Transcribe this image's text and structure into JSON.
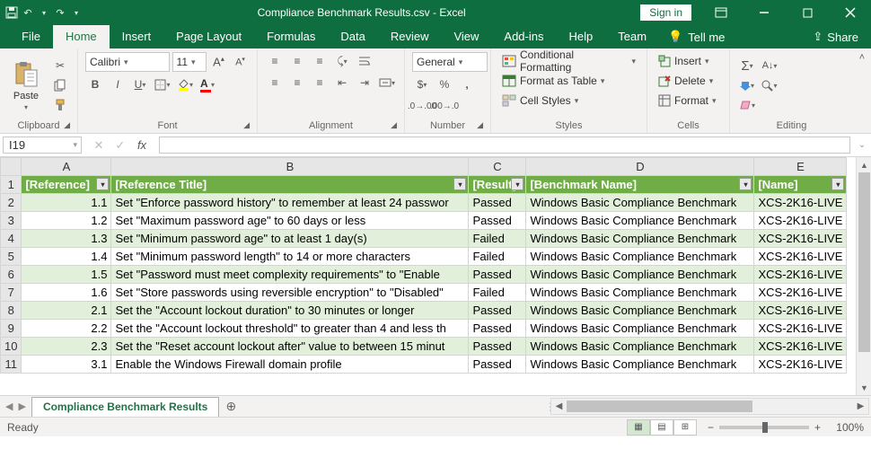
{
  "app": {
    "title": "Compliance Benchmark Results.csv  -  Excel",
    "signin": "Sign in"
  },
  "qat": {
    "save": "💾",
    "undo": "↶",
    "redo": "↷"
  },
  "tabs": {
    "file": "File",
    "home": "Home",
    "insert": "Insert",
    "pagelayout": "Page Layout",
    "formulas": "Formulas",
    "data": "Data",
    "review": "Review",
    "view": "View",
    "addins": "Add-ins",
    "help": "Help",
    "team": "Team",
    "tellme": "Tell me",
    "share": "Share"
  },
  "ribbon": {
    "clipboard": {
      "label": "Clipboard",
      "paste": "Paste"
    },
    "font": {
      "label": "Font",
      "face": "Calibri",
      "size": "11"
    },
    "alignment": {
      "label": "Alignment"
    },
    "number": {
      "label": "Number",
      "format": "General"
    },
    "styles": {
      "label": "Styles",
      "cond": "Conditional Formatting",
      "table": "Format as Table",
      "cell": "Cell Styles"
    },
    "cells": {
      "label": "Cells",
      "insert": "Insert",
      "delete": "Delete",
      "format": "Format"
    },
    "editing": {
      "label": "Editing"
    }
  },
  "formula": {
    "cellref": "I19"
  },
  "cols": [
    "A",
    "B",
    "C",
    "D",
    "E"
  ],
  "headers": {
    "a": "[Reference]",
    "b": "[Reference Title]",
    "c": "[Result]",
    "d": "[Benchmark Name]",
    "e": "[Name]"
  },
  "rows": [
    {
      "n": 2,
      "a": "1.1",
      "b": "Set \"Enforce password history\" to remember at least 24 passwor",
      "c": "Passed",
      "d": "Windows Basic Compliance Benchmark",
      "e": "XCS-2K16-LIVE",
      "band": "A"
    },
    {
      "n": 3,
      "a": "1.2",
      "b": "Set \"Maximum password age\" to 60 days or less",
      "c": "Passed",
      "d": "Windows Basic Compliance Benchmark",
      "e": "XCS-2K16-LIVE",
      "band": "B"
    },
    {
      "n": 4,
      "a": "1.3",
      "b": "Set \"Minimum password age\" to at least 1 day(s)",
      "c": "Failed",
      "d": "Windows Basic Compliance Benchmark",
      "e": "XCS-2K16-LIVE",
      "band": "A"
    },
    {
      "n": 5,
      "a": "1.4",
      "b": "Set \"Minimum password length\" to 14 or more characters",
      "c": "Failed",
      "d": "Windows Basic Compliance Benchmark",
      "e": "XCS-2K16-LIVE",
      "band": "B"
    },
    {
      "n": 6,
      "a": "1.5",
      "b": "Set \"Password must meet complexity requirements\" to \"Enable",
      "c": "Passed",
      "d": "Windows Basic Compliance Benchmark",
      "e": "XCS-2K16-LIVE",
      "band": "A"
    },
    {
      "n": 7,
      "a": "1.6",
      "b": "Set \"Store passwords using reversible encryption\" to \"Disabled\"",
      "c": "Failed",
      "d": "Windows Basic Compliance Benchmark",
      "e": "XCS-2K16-LIVE",
      "band": "B"
    },
    {
      "n": 8,
      "a": "2.1",
      "b": "Set the \"Account lockout duration\" to 30 minutes or longer",
      "c": "Passed",
      "d": "Windows Basic Compliance Benchmark",
      "e": "XCS-2K16-LIVE",
      "band": "A"
    },
    {
      "n": 9,
      "a": "2.2",
      "b": "Set the \"Account lockout threshold\" to greater than 4 and less th",
      "c": "Passed",
      "d": "Windows Basic Compliance Benchmark",
      "e": "XCS-2K16-LIVE",
      "band": "B"
    },
    {
      "n": 10,
      "a": "2.3",
      "b": "Set the \"Reset account lockout after\" value to between 15 minut",
      "c": "Passed",
      "d": "Windows Basic Compliance Benchmark",
      "e": "XCS-2K16-LIVE",
      "band": "A"
    },
    {
      "n": 11,
      "a": "3.1",
      "b": "Enable the Windows Firewall domain profile",
      "c": "Passed",
      "d": "Windows Basic Compliance Benchmark",
      "e": "XCS-2K16-LIVE",
      "band": "B"
    }
  ],
  "sheettab": "Compliance Benchmark Results",
  "status": {
    "mode": "Ready",
    "zoom": "100%"
  }
}
